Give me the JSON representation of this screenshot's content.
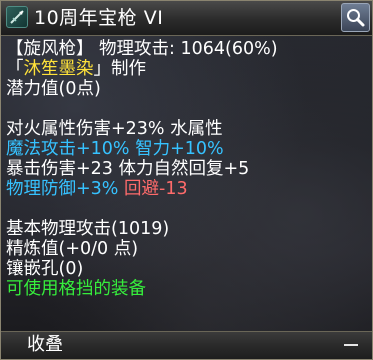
{
  "title": {
    "icon": "spear-icon",
    "text": "10周年宝枪 VI",
    "search_icon": "magnifier-icon"
  },
  "lines": [
    {
      "segments": [
        {
          "text": "【旋风枪】 物理攻击: 1064(60%)",
          "color": "white"
        }
      ]
    },
    {
      "segments": [
        {
          "text": "「",
          "color": "white"
        },
        {
          "text": "沐笙墨染",
          "color": "yellow"
        },
        {
          "text": "」制作",
          "color": "white"
        }
      ]
    },
    {
      "segments": [
        {
          "text": "潜力值(0点)",
          "color": "white"
        }
      ]
    },
    {
      "blank": true
    },
    {
      "segments": [
        {
          "text": "对火属性伤害+23% 水属性",
          "color": "white"
        }
      ]
    },
    {
      "segments": [
        {
          "text": "魔法攻击+10% 智力+10%",
          "color": "cyan"
        }
      ]
    },
    {
      "segments": [
        {
          "text": "暴击伤害+23 体力自然回复+5",
          "color": "white"
        }
      ]
    },
    {
      "segments": [
        {
          "text": "物理防御+3% ",
          "color": "cyan"
        },
        {
          "text": "回避-13",
          "color": "red"
        }
      ]
    },
    {
      "blank": true
    },
    {
      "segments": [
        {
          "text": "基本物理攻击(1019)",
          "color": "white"
        }
      ]
    },
    {
      "segments": [
        {
          "text": "精炼值(+0/0 点)",
          "color": "white"
        }
      ]
    },
    {
      "segments": [
        {
          "text": "镶嵌孔(0)",
          "color": "white"
        }
      ]
    },
    {
      "segments": [
        {
          "text": "可使用格挡的装备",
          "color": "green"
        }
      ]
    }
  ],
  "footer": {
    "collapse_label": "收叠",
    "minus_icon": "minus-icon"
  },
  "colors": {
    "white": "#ffffff",
    "yellow": "#ffe23a",
    "cyan": "#36c2ff",
    "green": "#36ee3c",
    "red": "#ff6b6b"
  }
}
